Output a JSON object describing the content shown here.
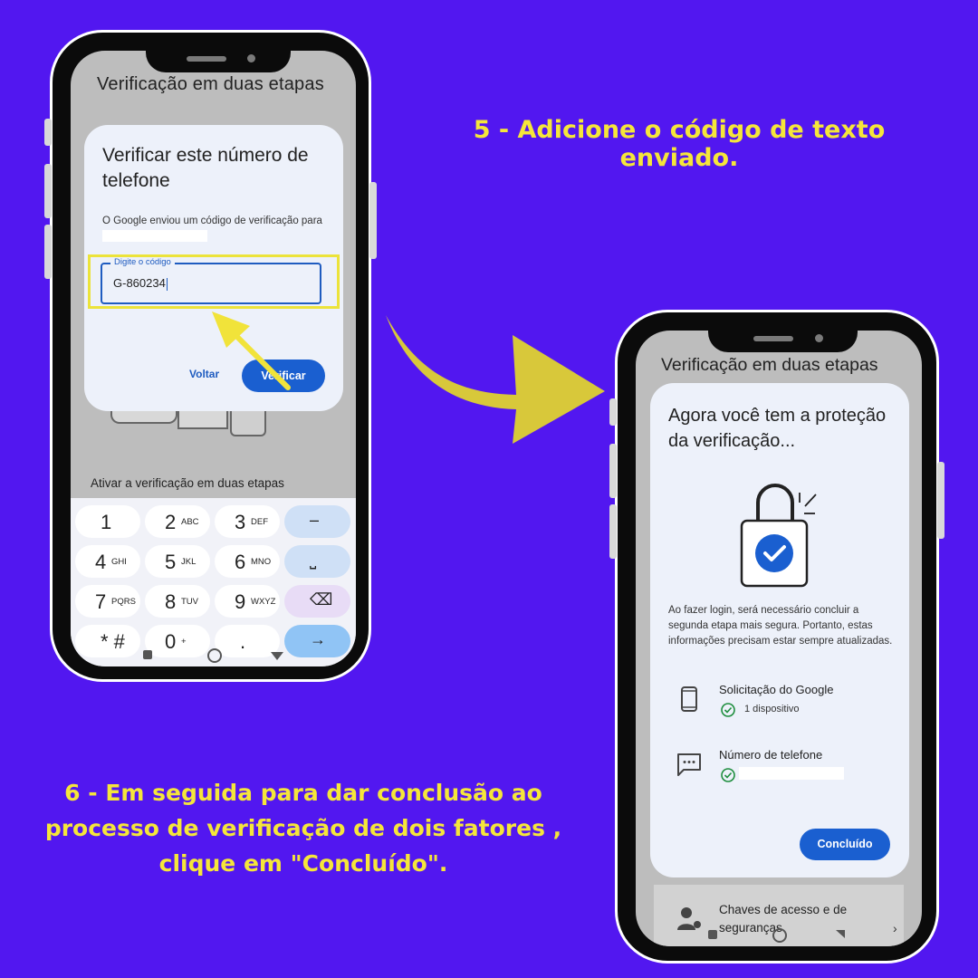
{
  "captions": {
    "step5": "5 - Adicione o código de texto enviado.",
    "step6": "6 - Em seguida para dar conclusão ao processo de verificação de dois fatores , clique em \"Concluído\"."
  },
  "left_phone": {
    "app_title": "Verificação em duas etapas",
    "dialog": {
      "title": "Verificar este número de telefone",
      "body": "O Google enviou um código de verificação para",
      "field_label": "Digite o código",
      "field_value": "G-860234",
      "back_button": "Voltar",
      "verify_button": "Verificar"
    },
    "activate_label": "Ativar a verificação em duas etapas",
    "keypad": [
      {
        "main": "1",
        "sub": ""
      },
      {
        "main": "2",
        "sub": "ABC"
      },
      {
        "main": "3",
        "sub": "DEF"
      },
      {
        "main": "–",
        "sub": ""
      },
      {
        "main": "4",
        "sub": "GHI"
      },
      {
        "main": "5",
        "sub": "JKL"
      },
      {
        "main": "6",
        "sub": "MNO"
      },
      {
        "main": "⎵",
        "sub": ""
      },
      {
        "main": "7",
        "sub": "PQRS"
      },
      {
        "main": "8",
        "sub": "TUV"
      },
      {
        "main": "9",
        "sub": "WXYZ"
      },
      {
        "main": "⌫",
        "sub": ""
      },
      {
        "main": "* #",
        "sub": ""
      },
      {
        "main": "0",
        "sub": "+"
      },
      {
        "main": ".",
        "sub": ""
      },
      {
        "main": "→",
        "sub": ""
      }
    ]
  },
  "right_phone": {
    "app_title": "Verificação em duas etapas",
    "dialog": {
      "title": "Agora você tem a proteção da verificação...",
      "body": "Ao fazer login, será necessário concluir a segunda etapa mais segura. Portanto, estas informações precisam estar sempre atualizadas.",
      "rows": [
        {
          "icon": "smartphone-icon",
          "title": "Solicitação do Google",
          "sub": "1 dispositivo"
        },
        {
          "icon": "message-icon",
          "title": "Número de telefone",
          "sub": ""
        }
      ],
      "done_button": "Concluído"
    },
    "behind_item": "Chaves de acesso e de seguranças"
  },
  "colors": {
    "background": "#5217f0",
    "caption": "#f5e63a",
    "accent_blue": "#1a5fd0",
    "highlight": "#ece33a",
    "check_green": "#1e8e3e"
  }
}
